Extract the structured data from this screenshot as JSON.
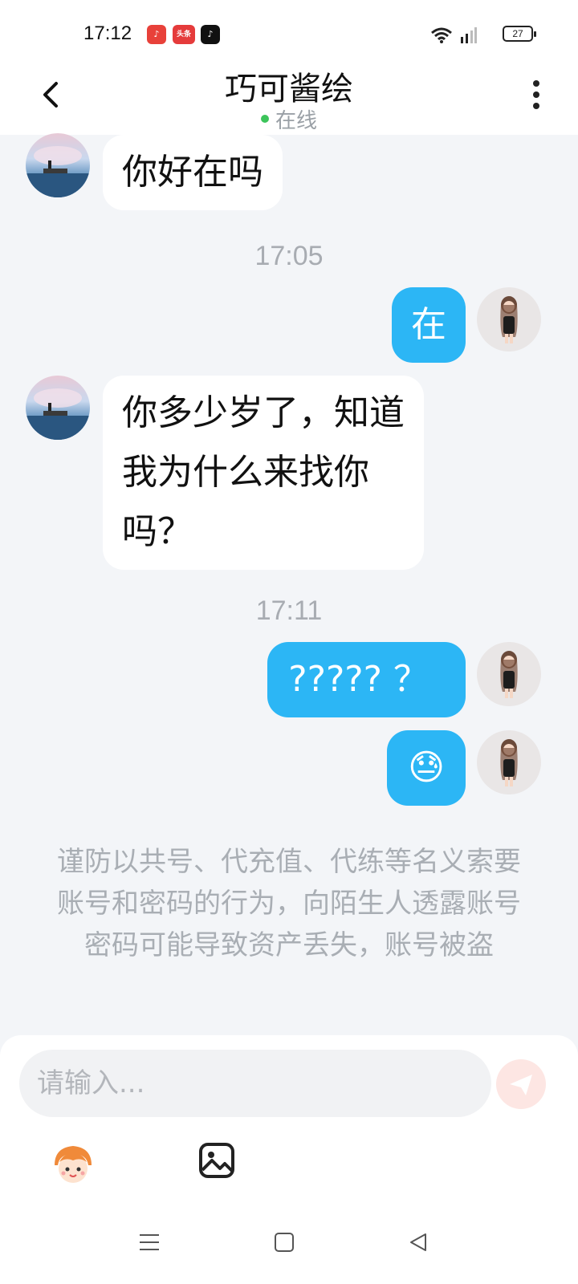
{
  "status_bar": {
    "time": "17:12",
    "app_icons": [
      "music-app-icon",
      "toutiao-app-icon",
      "tiktok-app-icon"
    ],
    "toutiao_label": "头条",
    "battery": "27"
  },
  "header": {
    "title": "巧可酱绘",
    "status": "在线"
  },
  "messages": [
    {
      "from": "peer",
      "text": "你好在吗"
    },
    {
      "type": "time",
      "text": "17:05"
    },
    {
      "from": "me",
      "text": "在"
    },
    {
      "from": "peer",
      "text": "你多少岁了，知道\n我为什么来找你\n吗？"
    },
    {
      "type": "time",
      "text": "17:11"
    },
    {
      "from": "me",
      "text": "????? ？"
    },
    {
      "from": "me",
      "text": "😓"
    }
  ],
  "notice": "谨防以共号、代充值、代练等名义索要账号和密码的行为，向陌生人透露账号密码可能导致资产丢失，账号被盗",
  "input": {
    "placeholder": "请输入..."
  },
  "colors": {
    "my_bubble": "#2cb6f5",
    "peer_bubble": "#ffffff",
    "online": "#3cc45a",
    "background": "#f3f5f8"
  }
}
